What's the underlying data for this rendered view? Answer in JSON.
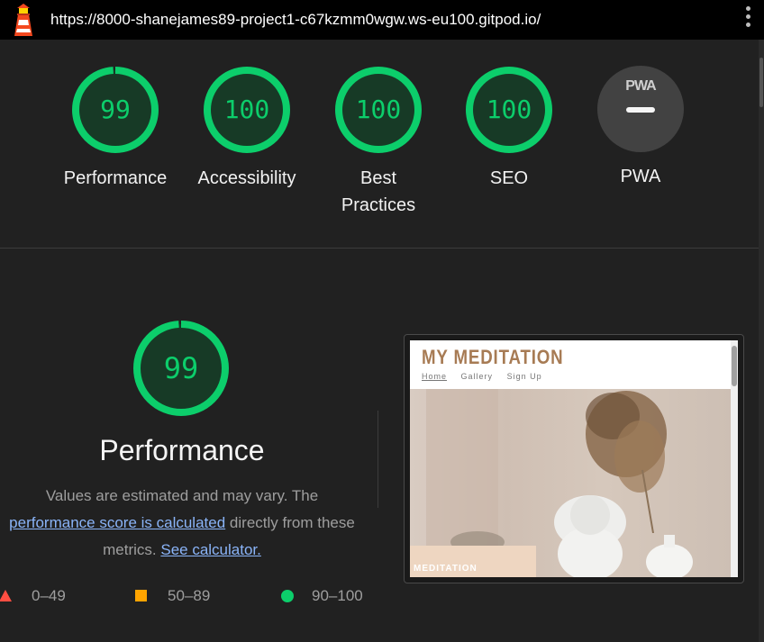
{
  "browser": {
    "url": "https://8000-shanejames89-project1-c67kzmm0wgw.ws-eu100.gitpod.io/",
    "logo_icon": "lighthouse-icon",
    "menu_icon": "vertical-dots-icon"
  },
  "categories": [
    {
      "score": "99",
      "label": "Performance",
      "score_fraction": 0.99
    },
    {
      "score": "100",
      "label": "Accessibility",
      "score_fraction": 1.0
    },
    {
      "score": "100",
      "label": "Best Practices",
      "score_fraction": 1.0
    },
    {
      "score": "100",
      "label": "SEO",
      "score_fraction": 1.0
    },
    {
      "badge": "PWA",
      "label": "PWA"
    }
  ],
  "performance": {
    "score": "99",
    "score_fraction": 0.99,
    "title": "Performance",
    "desc_prefix": "Values are estimated and may vary. The",
    "link_score": "performance score is calculated",
    "desc_middle": "directly from these metrics.",
    "link_calculator": "See calculator."
  },
  "legend": [
    {
      "range": "0–49",
      "icon": "fail-triangle-icon",
      "color": "#ff4e42"
    },
    {
      "range": "50–89",
      "icon": "average-square-icon",
      "color": "#ffa400"
    },
    {
      "range": "90–100",
      "icon": "pass-circle-icon",
      "color": "#0cce6b"
    }
  ],
  "screenshot": {
    "site_title": "MY MEDITATION",
    "nav": [
      "Home",
      "Gallery",
      "Sign Up"
    ],
    "hero_caption": "MEDITATION"
  },
  "colors": {
    "pass": "#0cce6b",
    "background": "#212121",
    "link": "#8ab4f8"
  }
}
